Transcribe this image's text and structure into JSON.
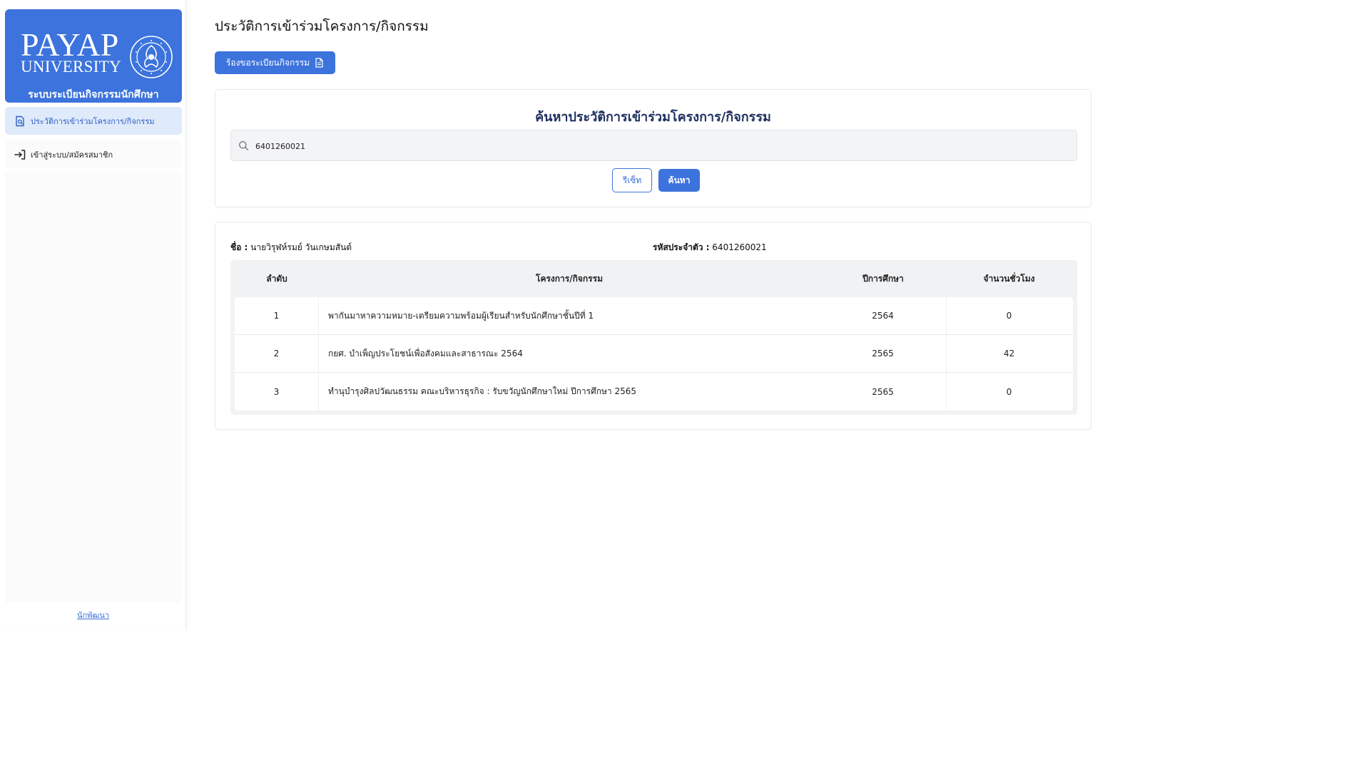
{
  "sidebar": {
    "brand": {
      "wordmark_line1": "PAYAP",
      "wordmark_line2": "UNIVERSITY",
      "seal_text_top": "PAYAP UNIVERSITY",
      "seal_text_bottom": "TRUTH · SERVICE",
      "subtitle": "ระบบระเบียนกิจกรรมนักศึกษา",
      "color": "#3c73dc"
    },
    "nav": [
      {
        "label": "ประวัติการเข้าร่วมโครงการ/กิจกรรม",
        "icon": "search-document-icon",
        "active": true
      },
      {
        "label": "เข้าสู่ระบบ/สมัครสมาชิก",
        "icon": "login-icon",
        "active": false
      }
    ],
    "footer_link": "นักพัฒนา"
  },
  "main": {
    "title": "ประวัติการเข้าร่วมโครงการ/กิจกรรม",
    "request_button": {
      "label": "ร้องขอระเบียนกิจกรรม",
      "icon": "document-icon"
    },
    "search": {
      "heading": "ค้นหาประวัติการเข้าร่วมโครงการ/กิจกรรม",
      "value": "6401260021",
      "reset_label": "รีเซ็ท",
      "submit_label": "ค้นหา"
    },
    "result": {
      "name_label": "ชื่อ :",
      "name_value": "นายวิรุฬห์รมย์ วันเกษมสันต์",
      "id_label": "รหัสประจำตัว :",
      "id_value": "6401260021",
      "columns": [
        "ลำดับ",
        "โครงการ/กิจกรรม",
        "ปีการศึกษา",
        "จำนวนชั่วโมง"
      ],
      "rows": [
        {
          "no": "1",
          "activity": "พากันมาหาความหมาย-เตรียมความพร้อมผู้เรียนสำหรับนักศึกษาชั้นปีที่ 1",
          "year": "2564",
          "hours": "0"
        },
        {
          "no": "2",
          "activity": "กยศ. บำเพ็ญประโยชน์เพื่อสังคมและสาธารณะ 2564",
          "year": "2565",
          "hours": "42"
        },
        {
          "no": "3",
          "activity": "ทำนุบำรุงศิลปวัฒนธรรม คณะบริหารธุรกิจ : รับขวัญนักศึกษาใหม่ ปีการศึกษา 2565",
          "year": "2565",
          "hours": "0"
        }
      ]
    }
  },
  "colors": {
    "accent": "#3c73dc",
    "nav_active_bg": "#dfeafb",
    "heading": "#1f2f5f"
  }
}
